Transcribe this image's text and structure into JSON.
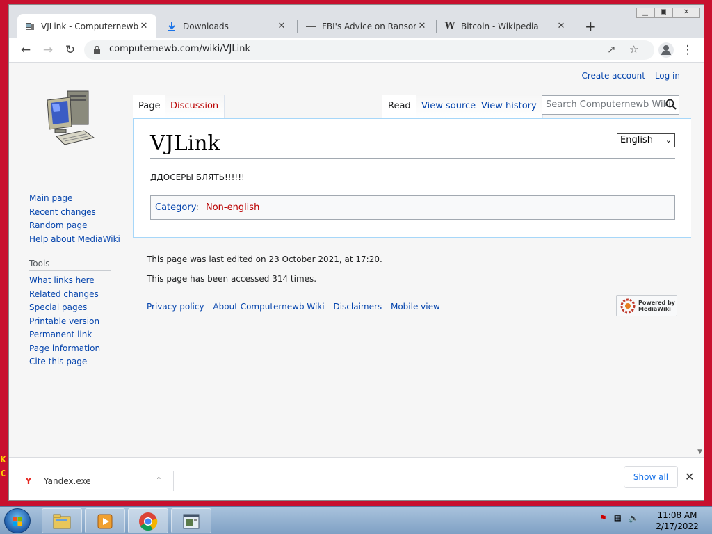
{
  "desktop": {
    "fragment_1": "K",
    "fragment_2": "C"
  },
  "browser": {
    "tabs": [
      {
        "title": "VJLink - Computernewb W",
        "icon": "wiki-computer-favicon",
        "active": true
      },
      {
        "title": "Downloads",
        "icon": "download-icon",
        "active": false
      },
      {
        "title": "FBI's Advice on Ransomwa",
        "icon": "page-icon",
        "active": false
      },
      {
        "title": "Bitcoin - Wikipedia",
        "icon": "wikipedia-w-icon",
        "active": false
      }
    ],
    "tab_close": "✕",
    "new_tab": "+",
    "url": "computernewb.com/wiki/VJLink",
    "window_controls": {
      "minimize": "▁",
      "maximize": "▣",
      "close": "✕"
    }
  },
  "wiki": {
    "user_menu": {
      "create_account": "Create account",
      "log_in": "Log in"
    },
    "nav_links": [
      "Main page",
      "Recent changes",
      "Random page",
      "Help about MediaWiki"
    ],
    "tools_heading": "Tools",
    "tools_links": [
      "What links here",
      "Related changes",
      "Special pages",
      "Printable version",
      "Permanent link",
      "Page information",
      "Cite this page"
    ],
    "content_tabs": {
      "page": "Page",
      "discussion": "Discussion",
      "read": "Read",
      "view_source": "View source",
      "view_history": "View history"
    },
    "search_placeholder": "Search Computernewb Wiki",
    "language_selected": "English",
    "page_title": "VJLink",
    "body_text": "ДДОСЕРЫ БЛЯТЬ!!!!!!",
    "category_label": "Category",
    "category_value": "Non-english",
    "footer": {
      "last_edited": "This page was last edited on 23 October 2021, at 17:20.",
      "accessed": "This page has been accessed 314 times.",
      "links": [
        "Privacy policy",
        "About Computernewb Wiki",
        "Disclaimers",
        "Mobile view"
      ],
      "powered_line1": "Powered by",
      "powered_line2": "MediaWiki"
    }
  },
  "downloads_shelf": {
    "file_name": "Yandex.exe",
    "show_all": "Show all",
    "close": "✕"
  },
  "taskbar": {
    "time": "11:08 AM",
    "date": "2/17/2022"
  }
}
